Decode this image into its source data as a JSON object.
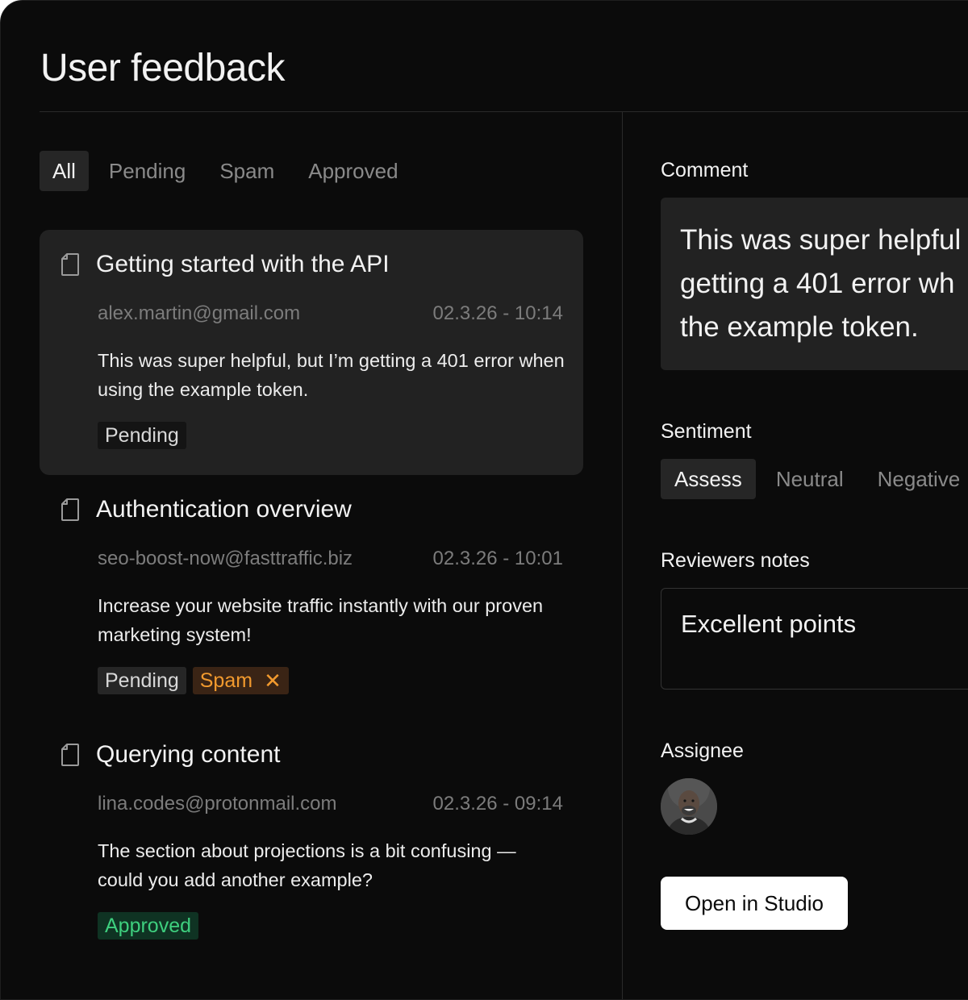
{
  "page": {
    "title": "User feedback"
  },
  "filters": {
    "tabs": [
      {
        "label": "All",
        "active": true
      },
      {
        "label": "Pending",
        "active": false
      },
      {
        "label": "Spam",
        "active": false
      },
      {
        "label": "Approved",
        "active": false
      }
    ]
  },
  "feedback": [
    {
      "title": "Getting started with the API",
      "email": "alex.martin@gmail.com",
      "date": "02.3.26 - 10:14",
      "body": "This was super helpful, but I’m getting a 401 error when using the example token.",
      "badges": [
        "Pending"
      ],
      "selected": true
    },
    {
      "title": "Authentication overview",
      "email": "seo-boost-now@fasttraffic.biz",
      "date": "02.3.26 - 10:01",
      "body": "Increase your website traffic instantly with our proven marketing system!",
      "badges": [
        "Pending",
        "Spam"
      ],
      "selected": false
    },
    {
      "title": "Querying content",
      "email": "lina.codes@protonmail.com",
      "date": "02.3.26 - 09:14",
      "body": "The section about projections is a bit confusing — could you add another example?",
      "badges": [
        "Approved"
      ],
      "selected": false
    }
  ],
  "detail": {
    "comment_label": "Comment",
    "comment_lines": [
      "This was super helpful",
      "getting a 401 error wh",
      "the example token."
    ],
    "sentiment_label": "Sentiment",
    "sentiment_options": [
      {
        "label": "Assess",
        "active": true
      },
      {
        "label": "Neutral",
        "active": false
      },
      {
        "label": "Negative",
        "active": false
      }
    ],
    "notes_label": "Reviewers notes",
    "notes_value": "Excellent points",
    "assignee_label": "Assignee",
    "open_button": "Open in Studio"
  },
  "colors": {
    "background": "#0b0b0b",
    "card_selected": "#222222",
    "spam": "#f29a2e",
    "approved": "#3ecf7e"
  }
}
